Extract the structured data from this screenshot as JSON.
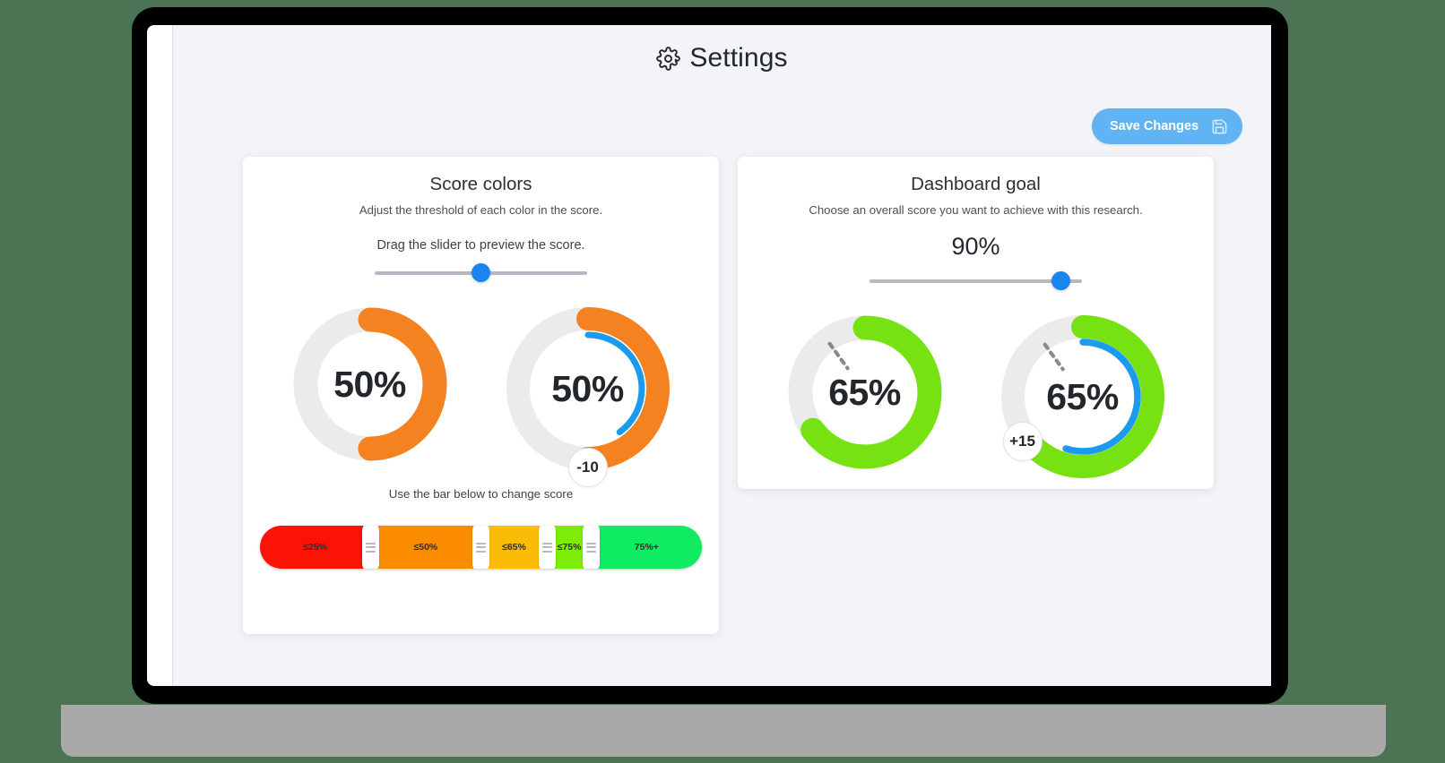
{
  "header": {
    "title": "Settings",
    "gear_icon": "gear-icon"
  },
  "toolbar": {
    "save_label": "Save Changes",
    "save_icon": "save-disk-icon",
    "save_bg": "#61b4f4"
  },
  "cards": {
    "score_colors": {
      "title": "Score colors",
      "subtitle": "Adjust the threshold of each color in the score.",
      "hint": "Drag the slider to preview the score.",
      "slider": {
        "value": 50,
        "min": 0,
        "max": 100
      },
      "donut_left": {
        "value_label": "50%",
        "percent": 50,
        "color": "#f58220",
        "track": "#ebebeb"
      },
      "donut_right": {
        "value_label": "50%",
        "percent": 50,
        "color": "#f58220",
        "inner_percent": 40,
        "inner_color": "#1b9bf0",
        "track": "#ebebeb",
        "badge": "-10"
      },
      "bar_hint": "Use the bar below to change score",
      "threshold_bar": {
        "segments": [
          {
            "label": "≤25%",
            "color": "#fb1405",
            "stop": 25
          },
          {
            "label": "≤50%",
            "color": "#fb8c00",
            "stop": 50
          },
          {
            "label": "≤65%",
            "color": "#fbbc05",
            "stop": 65
          },
          {
            "label": "≤75%",
            "color": "#7ded07",
            "stop": 75
          },
          {
            "label": "75%+",
            "color": "#10ec62",
            "stop": 100
          }
        ],
        "handles": [
          25,
          50,
          65,
          75
        ]
      }
    },
    "dashboard_goal": {
      "title": "Dashboard goal",
      "subtitle": "Choose an overall score you want to achieve with this research.",
      "value_label": "90%",
      "slider": {
        "value": 90,
        "min": 0,
        "max": 100
      },
      "donut_left": {
        "value_label": "65%",
        "percent": 65,
        "color": "#76e211",
        "track": "#ebebeb",
        "goal_marker": 90
      },
      "donut_right": {
        "value_label": "65%",
        "percent": 65,
        "color": "#76e211",
        "inner_percent": 55,
        "inner_color": "#1b9bf0",
        "track": "#ebebeb",
        "goal_marker": 90,
        "badge": "+15"
      }
    }
  }
}
